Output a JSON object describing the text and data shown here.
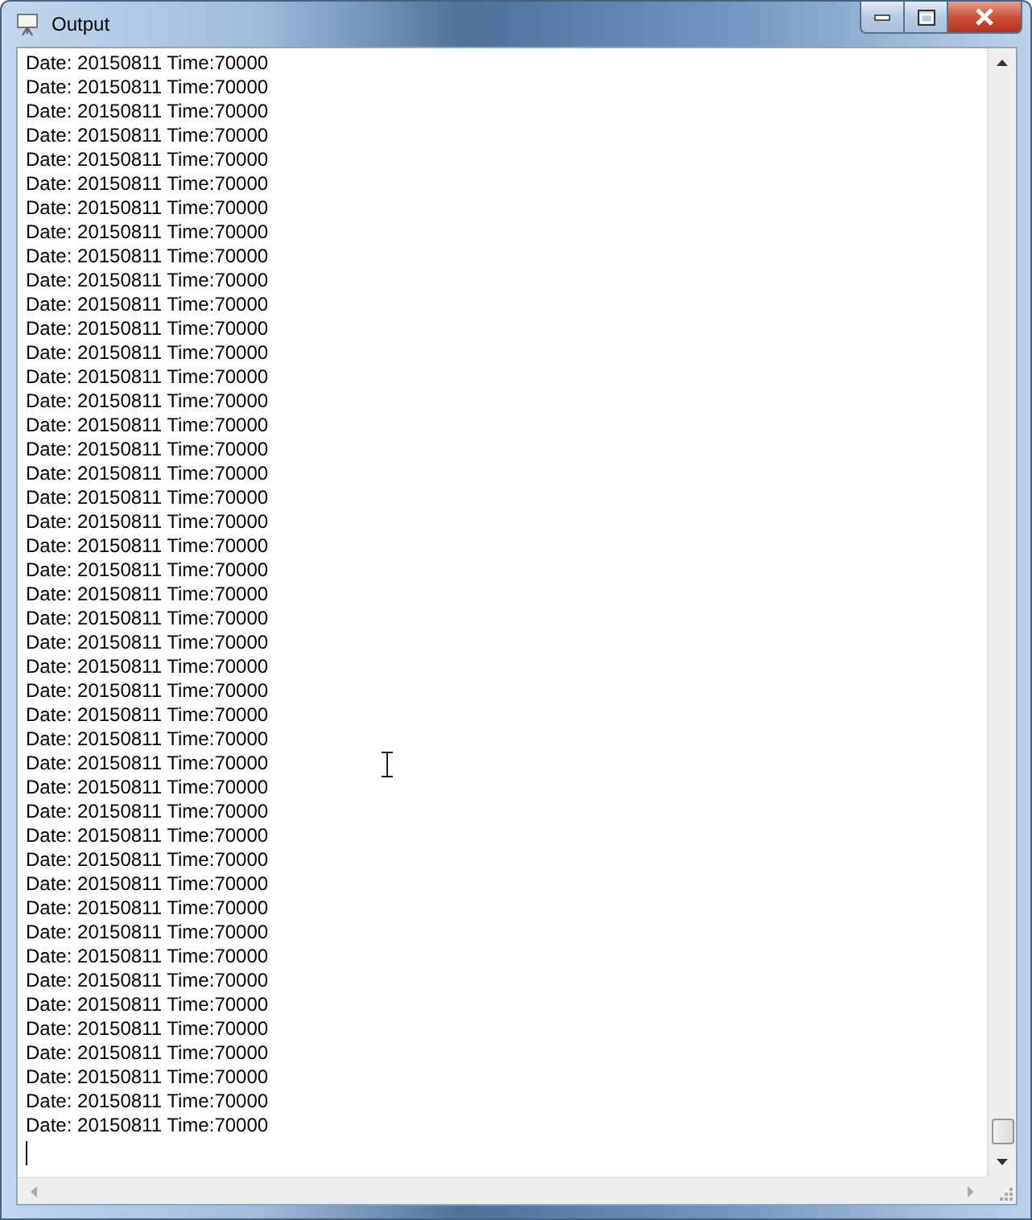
{
  "window": {
    "title": "Output"
  },
  "lines": [
    "Date: 20150811 Time:70000",
    "Date: 20150811 Time:70000",
    "Date: 20150811 Time:70000",
    "Date: 20150811 Time:70000",
    "Date: 20150811 Time:70000",
    "Date: 20150811 Time:70000",
    "Date: 20150811 Time:70000",
    "Date: 20150811 Time:70000",
    "Date: 20150811 Time:70000",
    "Date: 20150811 Time:70000",
    "Date: 20150811 Time:70000",
    "Date: 20150811 Time:70000",
    "Date: 20150811 Time:70000",
    "Date: 20150811 Time:70000",
    "Date: 20150811 Time:70000",
    "Date: 20150811 Time:70000",
    "Date: 20150811 Time:70000",
    "Date: 20150811 Time:70000",
    "Date: 20150811 Time:70000",
    "Date: 20150811 Time:70000",
    "Date: 20150811 Time:70000",
    "Date: 20150811 Time:70000",
    "Date: 20150811 Time:70000",
    "Date: 20150811 Time:70000",
    "Date: 20150811 Time:70000",
    "Date: 20150811 Time:70000",
    "Date: 20150811 Time:70000",
    "Date: 20150811 Time:70000",
    "Date: 20150811 Time:70000",
    "Date: 20150811 Time:70000",
    "Date: 20150811 Time:70000",
    "Date: 20150811 Time:70000",
    "Date: 20150811 Time:70000",
    "Date: 20150811 Time:70000",
    "Date: 20150811 Time:70000",
    "Date: 20150811 Time:70000",
    "Date: 20150811 Time:70000",
    "Date: 20150811 Time:70000",
    "Date: 20150811 Time:70000",
    "Date: 20150811 Time:70000",
    "Date: 20150811 Time:70000",
    "Date: 20150811 Time:70000",
    "Date: 20150811 Time:70000",
    "Date: 20150811 Time:70000",
    "Date: 20150811 Time:70000"
  ]
}
